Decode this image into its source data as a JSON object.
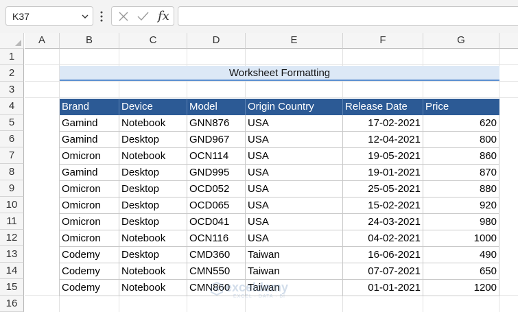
{
  "formula_bar": {
    "name_box": "K37",
    "fx_label": "fx",
    "formula": ""
  },
  "columns": [
    "A",
    "B",
    "C",
    "D",
    "E",
    "F",
    "G"
  ],
  "rows": [
    "1",
    "2",
    "3",
    "4",
    "5",
    "6",
    "7",
    "8",
    "9",
    "10",
    "11",
    "12",
    "13",
    "14",
    "15",
    "16"
  ],
  "title": "Worksheet Formatting",
  "table": {
    "headers": [
      "Brand",
      "Device",
      "Model",
      "Origin Country",
      "Release Date",
      "Price"
    ],
    "rows": [
      [
        "Gamind",
        "Notebook",
        "GNN876",
        "USA",
        "17-02-2021",
        "620"
      ],
      [
        "Gamind",
        "Desktop",
        "GND967",
        "USA",
        "12-04-2021",
        "800"
      ],
      [
        "Omicron",
        "Notebook",
        "OCN114",
        "USA",
        "19-05-2021",
        "860"
      ],
      [
        "Gamind",
        "Desktop",
        "GND995",
        "USA",
        "19-01-2021",
        "870"
      ],
      [
        "Omicron",
        "Desktop",
        "OCD052",
        "USA",
        "25-05-2021",
        "880"
      ],
      [
        "Omicron",
        "Desktop",
        "OCD065",
        "USA",
        "15-02-2021",
        "920"
      ],
      [
        "Omicron",
        "Desktop",
        "OCD041",
        "USA",
        "24-03-2021",
        "980"
      ],
      [
        "Omicron",
        "Notebook",
        "OCN116",
        "USA",
        "04-02-2021",
        "1000"
      ],
      [
        "Codemy",
        "Desktop",
        "CMD360",
        "Taiwan",
        "16-06-2021",
        "490"
      ],
      [
        "Codemy",
        "Notebook",
        "CMN550",
        "Taiwan",
        "07-07-2021",
        "650"
      ],
      [
        "Codemy",
        "Notebook",
        "CMN860",
        "Taiwan",
        "01-01-2021",
        "1200"
      ]
    ]
  },
  "watermark": {
    "name": "exceldemy",
    "tagline": "EXCEL · DATA · BI"
  },
  "colors": {
    "header_bg": "#2c5a95",
    "title_bg": "#dce8f6",
    "title_border": "#5b8fd0"
  }
}
